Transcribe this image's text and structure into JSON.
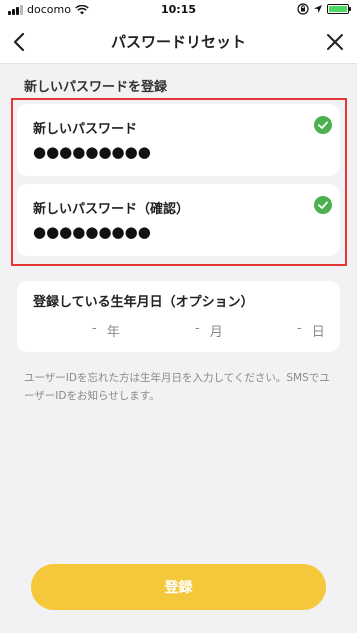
{
  "status_bar": {
    "carrier": "docomo",
    "time": "10:15",
    "icons": [
      "signal-icon",
      "wifi-icon",
      "orientation-lock-icon",
      "location-icon",
      "battery-charging-icon"
    ],
    "battery_color": "#4cd964"
  },
  "nav": {
    "back_icon": "chevron-left-icon",
    "title": "パスワードリセット",
    "close_icon": "close-icon"
  },
  "section_title": "新しいパスワードを登録",
  "password_fields": [
    {
      "label": "新しいパスワード",
      "value": "●●●●●●●●●",
      "status_icon": "check-circle-icon"
    },
    {
      "label": "新しいパスワード（確認）",
      "value": "●●●●●●●●●",
      "status_icon": "check-circle-icon"
    }
  ],
  "birth_date": {
    "label": "登録している生年月日（オプション）",
    "year_value": "-",
    "year_unit": "年",
    "month_value": "-",
    "month_unit": "月",
    "day_value": "-",
    "day_unit": "日"
  },
  "help_text": "ユーザーIDを忘れた方は生年月日を入力してください。SMSでユーザーIDをお知らせします。",
  "submit_label": "登録",
  "colors": {
    "accent": "#f5c73b",
    "check": "#4caf50",
    "highlight_border": "#e53935",
    "background": "#f2f2f4"
  }
}
